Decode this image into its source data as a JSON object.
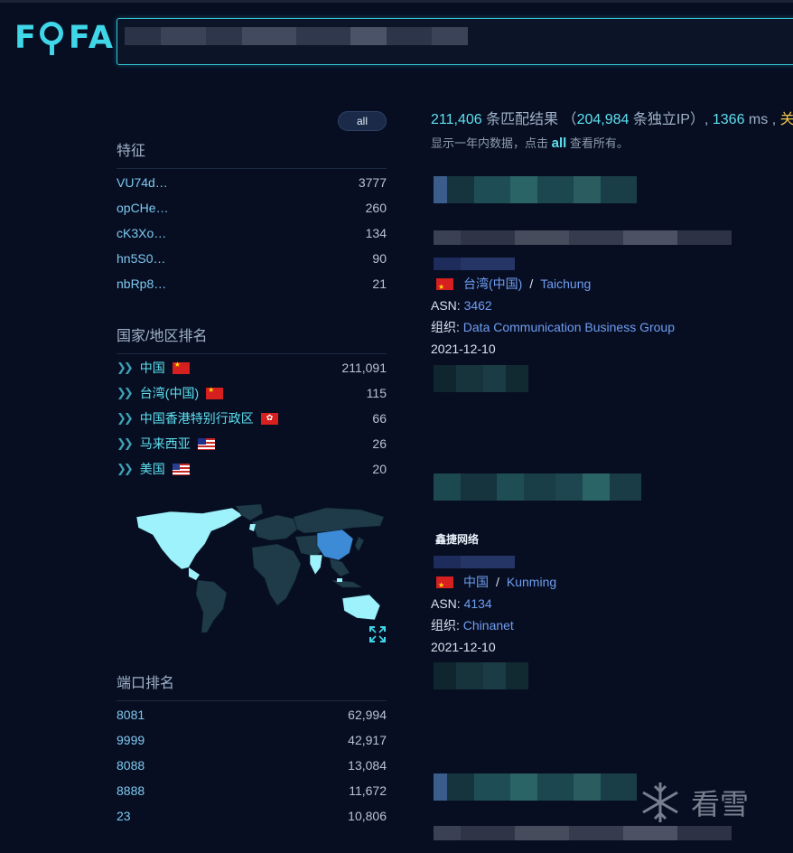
{
  "header": {
    "logo": "FOFA",
    "search_value": ""
  },
  "left": {
    "all_button": "all",
    "features": {
      "title": "特征",
      "items": [
        {
          "key": "VU74d…",
          "count": "3777"
        },
        {
          "key": "opCHe…",
          "count": "260"
        },
        {
          "key": "cK3Xo…",
          "count": "134"
        },
        {
          "key": "hn5S0…",
          "count": "90"
        },
        {
          "key": "nbRp8…",
          "count": "21"
        }
      ]
    },
    "countries": {
      "title": "国家/地区排名",
      "items": [
        {
          "name": "中国",
          "flag": "cn",
          "count": "211,091"
        },
        {
          "name": "台湾(中国)",
          "flag": "cn",
          "count": "115"
        },
        {
          "name": "中国香港特别行政区",
          "flag": "hk",
          "count": "66"
        },
        {
          "name": "马来西亚",
          "flag": "my",
          "count": "26"
        },
        {
          "name": "美国",
          "flag": "us",
          "count": "20"
        }
      ]
    },
    "ports": {
      "title": "端口排名",
      "items": [
        {
          "port": "8081",
          "count": "62,994"
        },
        {
          "port": "9999",
          "count": "42,917"
        },
        {
          "port": "8088",
          "count": "13,084"
        },
        {
          "port": "8888",
          "count": "11,672"
        },
        {
          "port": "23",
          "count": "10,806"
        }
      ]
    }
  },
  "summary": {
    "matches": "211,406",
    "matches_label": " 条匹配结果 （",
    "unique_ips": "204,984",
    "unique_label": " 条独立IP）, ",
    "time": "1366",
    "time_label": " ms , ",
    "tail": "关",
    "note_prefix": "显示一年内数据，点击 ",
    "note_link": "all",
    "note_suffix": " 查看所有。"
  },
  "results": [
    {
      "country": "台湾(中国)",
      "flag": "cn",
      "city": "Taichung",
      "asn_label": "ASN:",
      "asn": "3462",
      "org_label": "组织:",
      "org": "Data Communication Business Group",
      "date": "2021-12-10"
    },
    {
      "country": "中国",
      "flag": "cn",
      "city": "Kunming",
      "asn_label": "ASN:",
      "asn": "4134",
      "org_label": "组织:",
      "org": "Chinanet",
      "date": "2021-12-10",
      "title": "鑫捷网络"
    }
  ],
  "icons": [
    "code-icon",
    "cube-icon",
    "expand-icon",
    "snowflake-icon"
  ],
  "watermark": "看雪",
  "colors": {
    "background": "#070e22",
    "accent": "#3fd6e8",
    "link": "#6f9df0",
    "highlight": "#f3c74a"
  }
}
